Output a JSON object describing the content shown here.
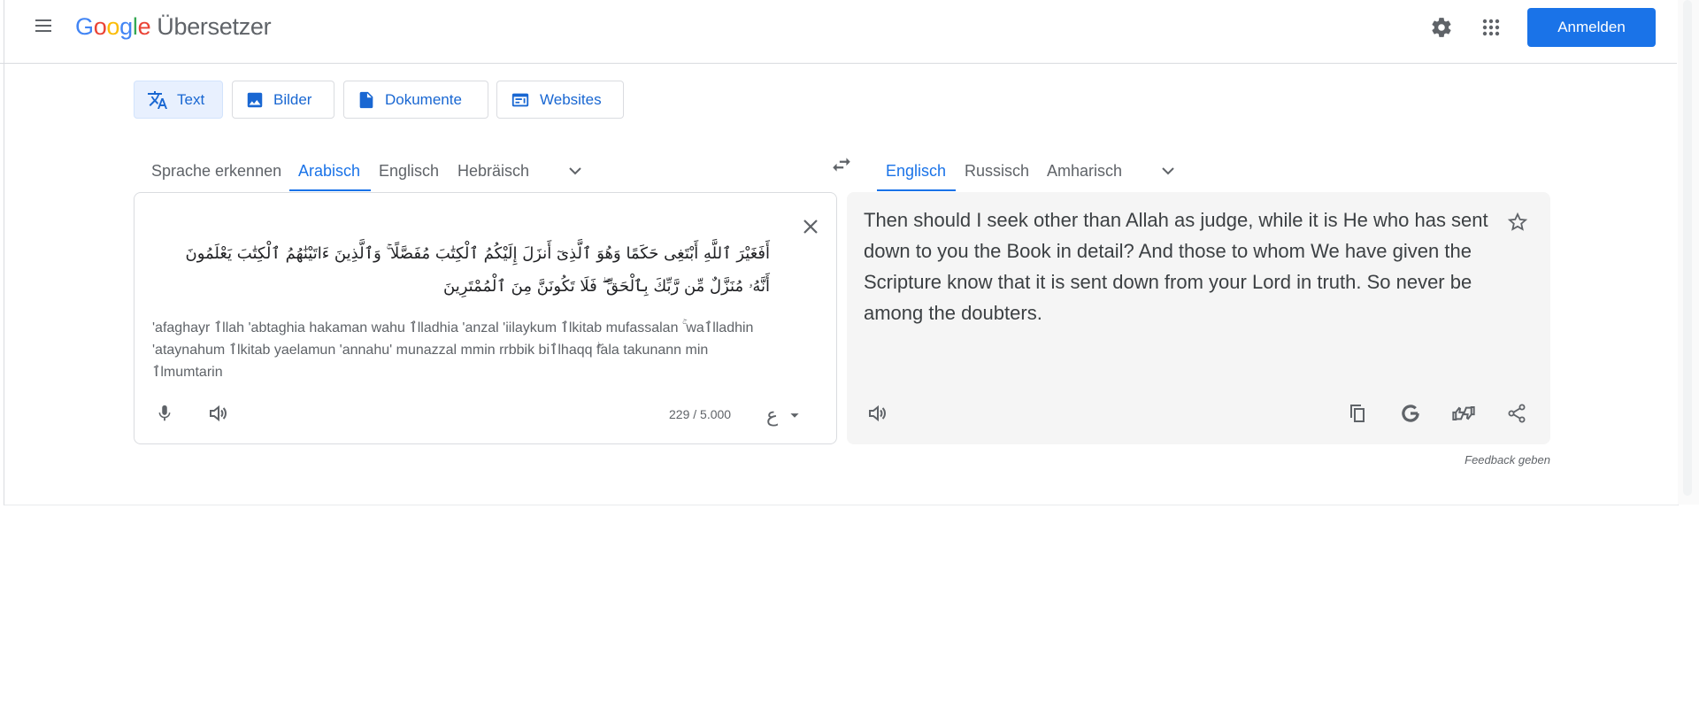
{
  "header": {
    "logo_letters": [
      "G",
      "o",
      "o",
      "g",
      "l",
      "e"
    ],
    "product_name": "Übersetzer",
    "signin_label": "Anmelden"
  },
  "modes": [
    {
      "label": "Text",
      "icon": "translate-icon",
      "active": true
    },
    {
      "label": "Bilder",
      "icon": "image-icon",
      "active": false
    },
    {
      "label": "Dokumente",
      "icon": "document-icon",
      "active": false
    },
    {
      "label": "Websites",
      "icon": "website-icon",
      "active": false
    }
  ],
  "source_languages": [
    {
      "label": "Sprache erkennen",
      "active": false
    },
    {
      "label": "Arabisch",
      "active": true
    },
    {
      "label": "Englisch",
      "active": false
    },
    {
      "label": "Hebräisch",
      "active": false
    }
  ],
  "target_languages": [
    {
      "label": "Englisch",
      "active": true
    },
    {
      "label": "Russisch",
      "active": false
    },
    {
      "label": "Amharisch",
      "active": false
    }
  ],
  "source": {
    "text": "أَفَغَيْرَ ٱللَّهِ أَبْتَغِى حَكَمًا وَهُوَ ٱلَّذِىٓ أَنزَلَ إِلَيْكُمُ ٱلْكِتَٰبَ مُفَصَّلًا ۚ وَٱلَّذِينَ ءَاتَيْنَٰهُمُ ٱلْكِتَٰبَ يَعْلَمُونَ أَنَّهُۥ مُنَزَّلٌ مِّن رَّبِّكَ بِٱلْحَقِّ ۖ فَلَا تَكُونَنَّ مِنَ ٱلْمُمْتَرِينَ",
    "transliteration": "'afaghayr ٱllah 'abtaghia hakaman wahu ٱlladhia 'anzal 'iilaykum ٱlkitab mufassalan ۚ waٱlladhin 'ataynahum ٱlkitab yaelamun 'annahu' munazzal mmin rrbbik biٱlhaqq ۖfala takunann min ٱlmumtarin",
    "char_count": "229 / 5.000",
    "keyboard_glyph": "ع"
  },
  "target": {
    "text": "Then should I seek other than Allah as judge, while it is He who has sent down to you the Book in detail? And those to whom We have given the Scripture know that it is sent down from your Lord in truth. So never be among the doubters."
  },
  "feedback_label": "Feedback geben",
  "colors": {
    "accent": "#1a73e8",
    "active_tab_bg": "#e8f0fe",
    "target_bg": "#f5f5f5"
  }
}
